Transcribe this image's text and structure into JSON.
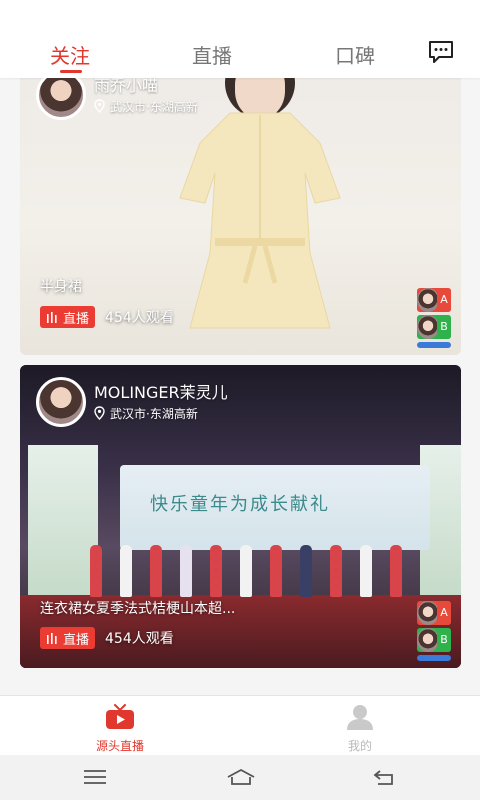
{
  "top_tabs": [
    {
      "label": "关注",
      "active": true
    },
    {
      "label": "直播",
      "active": false
    },
    {
      "label": "口碑",
      "active": false
    }
  ],
  "cards": [
    {
      "streamer_name": "雨乔小喵",
      "location": "武汉市·东湖高新",
      "title": "半身裙",
      "live_label": "直播",
      "viewers": "454人观看",
      "thumb_tags": [
        "A",
        "B"
      ]
    },
    {
      "streamer_name": "MOLINGER茉灵儿",
      "location": "武汉市·东湖高新",
      "title": "连衣裙女夏季法式桔梗山本超...",
      "live_label": "直播",
      "viewers": "454人观看",
      "banner_text": "快乐童年为成长献礼",
      "thumb_tags": [
        "A",
        "B"
      ]
    }
  ],
  "bottom_nav": [
    {
      "label": "源头直播",
      "icon": "tv-play-icon",
      "active": true
    },
    {
      "label": "我的",
      "icon": "user-icon",
      "active": false
    }
  ],
  "colors": {
    "accent": "#e0382f",
    "live_badge": "#ea3c33"
  }
}
